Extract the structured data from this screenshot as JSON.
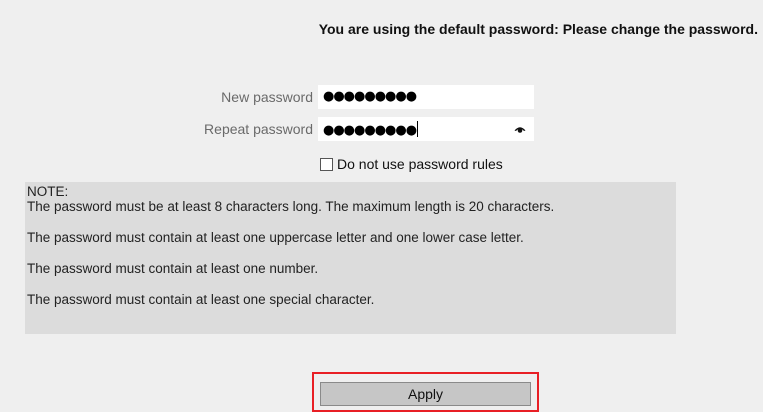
{
  "banner": {
    "text": "You are using the default password: Please change the password."
  },
  "form": {
    "new_password": {
      "label": "New password",
      "value_masked": "●●●●●●●●●"
    },
    "repeat_password": {
      "label": "Repeat password",
      "value_masked": "●●●●●●●●●",
      "reveal_icon": "eye-icon"
    },
    "rules_checkbox": {
      "label": "Do not use password rules",
      "checked": false
    }
  },
  "note": {
    "title": "NOTE:",
    "lines": [
      "The password must be at least 8 characters long. The maximum length is 20 characters.",
      "The password must contain at least one uppercase letter and one lower case letter.",
      "The password must contain at least one number.",
      "The password must contain at least one special character."
    ]
  },
  "actions": {
    "apply_label": "Apply",
    "highlight_color": "#e81f25"
  }
}
